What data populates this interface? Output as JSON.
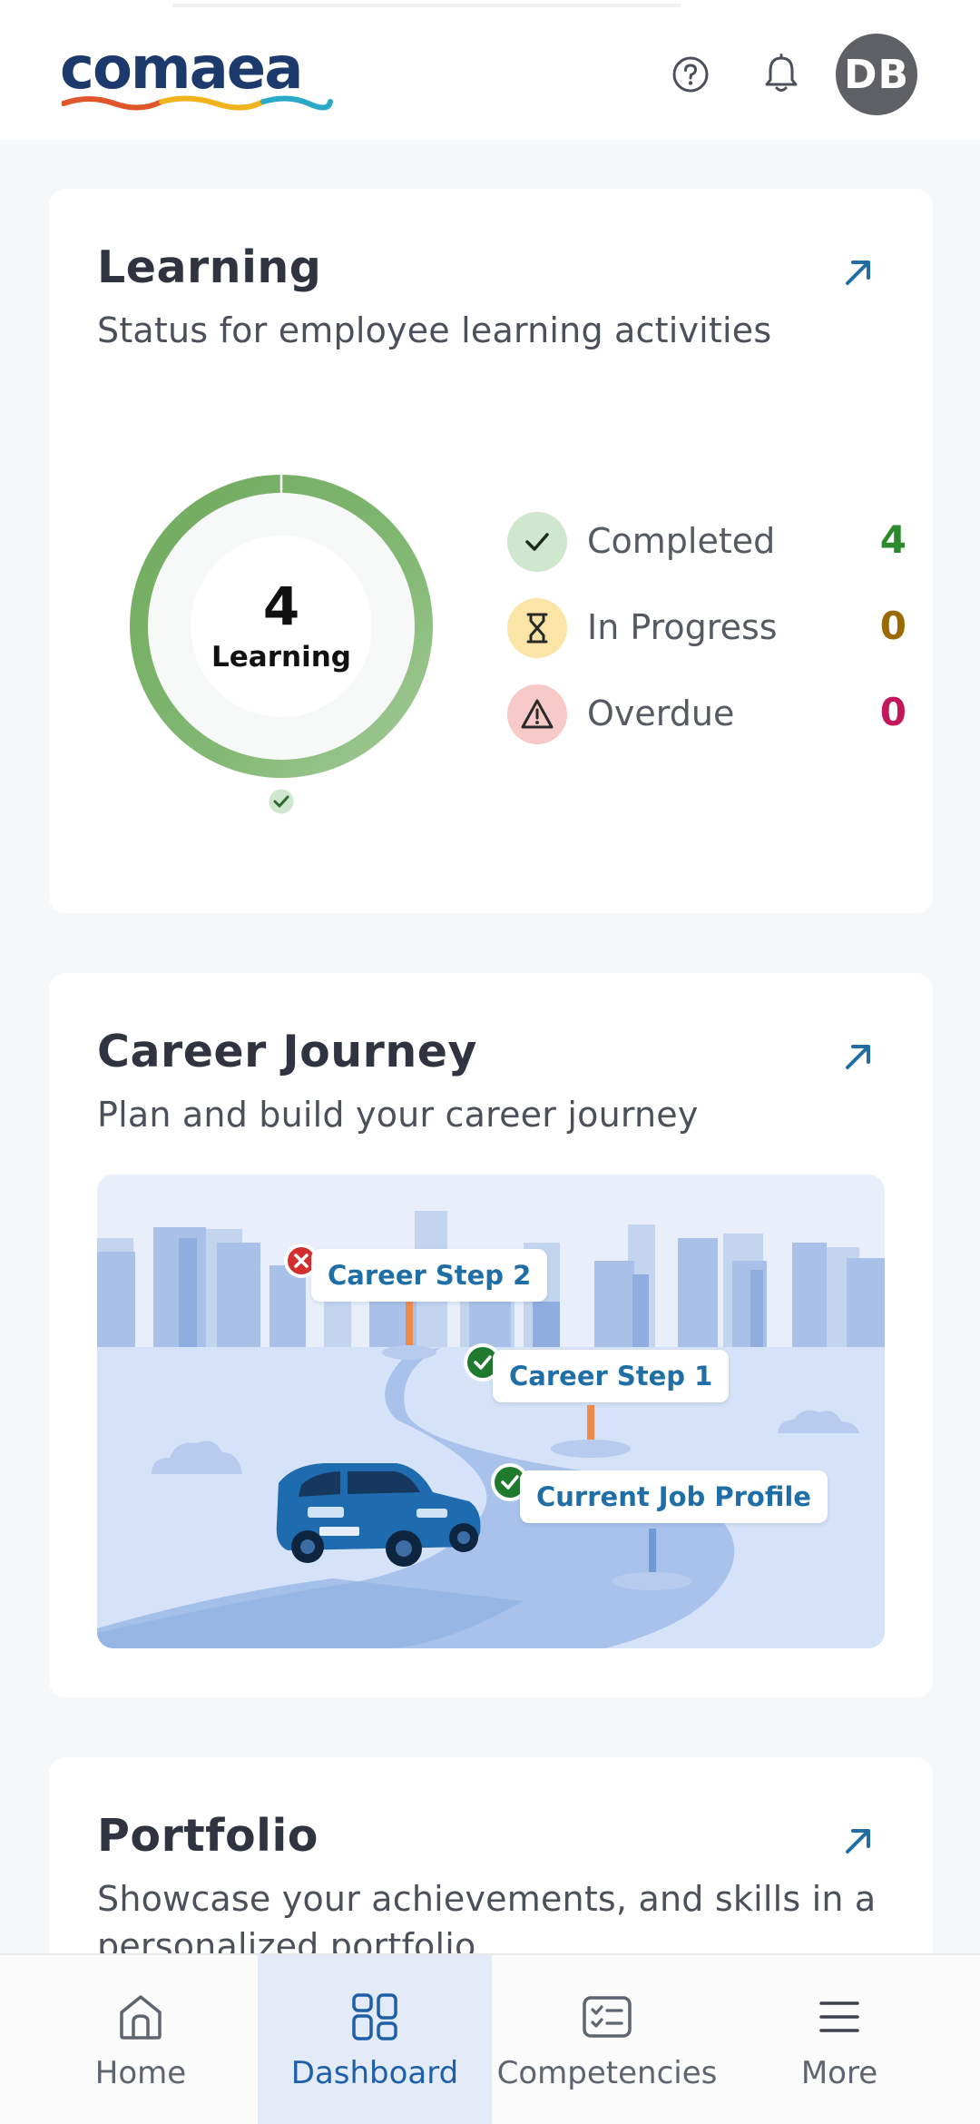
{
  "header": {
    "logo_text": "comaea",
    "help_icon": "help-circle-icon",
    "notifications_icon": "bell-icon",
    "avatar_initials": "DB"
  },
  "learning": {
    "title": "Learning",
    "subtitle": "Status for employee learning activities",
    "total": "4",
    "center_label": "Learning",
    "stats": [
      {
        "label": "Completed",
        "value": "4",
        "icon": "check-icon",
        "color": "#2e8a2e",
        "badge": "#cfe6cf"
      },
      {
        "label": "In Progress",
        "value": "0",
        "icon": "hourglass-icon",
        "color": "#9a6a00",
        "badge": "#fbe5a6"
      },
      {
        "label": "Overdue",
        "value": "0",
        "icon": "warning-icon",
        "color": "#c2185b",
        "badge": "#f8c9c9"
      }
    ],
    "ring_color": "#7ab46a"
  },
  "career": {
    "title": "Career Journey",
    "subtitle": "Plan and build your career journey",
    "steps": [
      {
        "label": "Career Step 2",
        "status": "blocked"
      },
      {
        "label": "Career Step 1",
        "status": "done"
      },
      {
        "label": "Current Job Profile",
        "status": "done"
      }
    ]
  },
  "portfolio": {
    "title": "Portfolio",
    "subtitle_line1": "Showcase your achievements, and skills in a",
    "subtitle_line2": "personalized portfolio"
  },
  "nav": {
    "items": [
      {
        "label": "Home",
        "icon": "home-icon",
        "active": false
      },
      {
        "label": "Dashboard",
        "icon": "dashboard-icon",
        "active": true
      },
      {
        "label": "Competencies",
        "icon": "competencies-icon",
        "active": false
      },
      {
        "label": "More",
        "icon": "menu-icon",
        "active": false
      }
    ]
  },
  "colors": {
    "accent": "#1f5fa8",
    "link_arrow": "#1f6ea6"
  }
}
